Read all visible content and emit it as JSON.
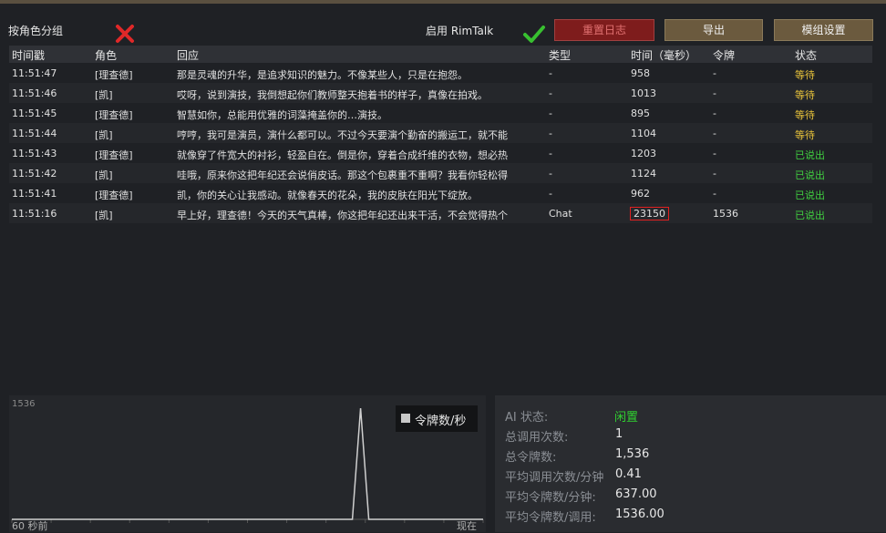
{
  "toolbar": {
    "group_by_role_label": "按角色分组",
    "group_by_role_icon": "close-icon",
    "enable_rimtalk_label": "启用 RimTalk",
    "enable_rimtalk_icon": "check-icon",
    "reset_log_label": "重置日志",
    "export_label": "导出",
    "mod_settings_label": "模组设置"
  },
  "table": {
    "headers": [
      "时间戳",
      "角色",
      "回应",
      "类型",
      "时间（毫秒）",
      "令牌",
      "状态"
    ],
    "rows": [
      {
        "time": "11:51:47",
        "role": "[理查德]",
        "reply": "那是灵魂的升华，是追求知识的魅力。不像某些人，只是在抱怨。",
        "type": "-",
        "ms": "958",
        "tokens": "-",
        "status": "等待"
      },
      {
        "time": "11:51:46",
        "role": "[凯]",
        "reply": "哎呀，说到演技，我倒想起你们教师整天抱着书的样子，真像在拍戏。",
        "type": "-",
        "ms": "1013",
        "tokens": "-",
        "status": "等待"
      },
      {
        "time": "11:51:45",
        "role": "[理查德]",
        "reply": "智慧如你，总能用优雅的词藻掩盖你的…演技。",
        "type": "-",
        "ms": "895",
        "tokens": "-",
        "status": "等待"
      },
      {
        "time": "11:51:44",
        "role": "[凯]",
        "reply": "哼哼，我可是演员，演什么都可以。不过今天要演个勤奋的搬运工，就不能",
        "type": "-",
        "ms": "1104",
        "tokens": "-",
        "status": "等待"
      },
      {
        "time": "11:51:43",
        "role": "[理查德]",
        "reply": "就像穿了件宽大的衬衫，轻盈自在。倒是你，穿着合成纤维的衣物，想必热",
        "type": "-",
        "ms": "1203",
        "tokens": "-",
        "status": "已说出"
      },
      {
        "time": "11:51:42",
        "role": "[凯]",
        "reply": "哇哦，原来你这把年纪还会说俏皮话。那这个包裹重不重啊？我看你轻松得",
        "type": "-",
        "ms": "1124",
        "tokens": "-",
        "status": "已说出"
      },
      {
        "time": "11:51:41",
        "role": "[理查德]",
        "reply": "凯，你的关心让我感动。就像春天的花朵，我的皮肤在阳光下绽放。",
        "type": "-",
        "ms": "962",
        "tokens": "-",
        "status": "已说出"
      },
      {
        "time": "11:51:16",
        "role": "[凯]",
        "reply": "早上好，理查德！今天的天气真棒，你这把年纪还出来干活，不会觉得热个",
        "type": "Chat",
        "ms": "23150",
        "tokens": "1536",
        "status": "已说出"
      }
    ]
  },
  "chart_data": {
    "type": "line",
    "title": "",
    "series": [
      {
        "name": "令牌数/秒",
        "x_labels": [
          "60 秒前",
          "现在"
        ],
        "spike_value": 1536,
        "baseline": 0
      }
    ],
    "ylim": [
      0,
      1536
    ],
    "y_max_label": "1536",
    "x_left_label": "60 秒前",
    "x_right_label": "现在",
    "legend": "令牌数/秒",
    "legend_placement": "top-right",
    "spike_position_fraction": 0.74
  },
  "stats": {
    "ai_status_label": "AI 状态:",
    "ai_status_value": "闲置",
    "total_calls_label": "总调用次数:",
    "total_calls_value": "1",
    "total_tokens_label": "总令牌数:",
    "total_tokens_value": "1,536",
    "avg_calls_label": "平均调用次数/分钟",
    "avg_calls_value": "0.41",
    "avg_tokens_label": "平均令牌数/分钟:",
    "avg_tokens_value": "637.00",
    "avg_tokens_per_call_label": "平均令牌数/调用:",
    "avg_tokens_per_call_value": "1536.00"
  },
  "colors": {
    "waiting": "#e8c33a",
    "spoken": "#40d040",
    "idle": "#30d030",
    "reset_button": "#7e1c1c",
    "button": "#6b5a3e"
  }
}
